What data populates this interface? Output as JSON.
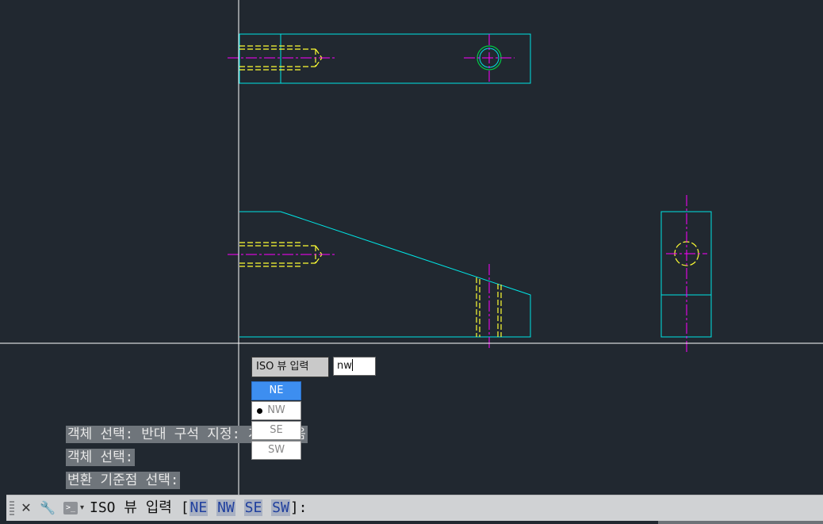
{
  "viewport": {
    "background": "#212830",
    "colors": {
      "object": "#00e5e5",
      "hidden": "#ffff33",
      "center": "#ff00ff",
      "hole_top": "#00cc44",
      "crosshair": "#ffffff"
    }
  },
  "dynamic_input": {
    "label": "ISO 뷰 입력",
    "value": "nw",
    "options": [
      {
        "label": "NE",
        "highlighted": true,
        "current": false
      },
      {
        "label": "NW",
        "highlighted": false,
        "current": true
      },
      {
        "label": "SE",
        "highlighted": false,
        "current": false
      },
      {
        "label": "SW",
        "highlighted": false,
        "current": false
      }
    ]
  },
  "history": [
    "객체 선택: 반대 구석 지정: 개를 찾음",
    "객체 선택:",
    "변환 기준점 선택:"
  ],
  "command_line": {
    "prompt": "ISO 뷰 입력 [",
    "keywords": [
      "NE",
      "NW",
      "SE",
      "SW"
    ],
    "suffix": "]:",
    "icons": [
      "close-icon",
      "wrench-icon",
      "command-prompt-icon"
    ]
  }
}
